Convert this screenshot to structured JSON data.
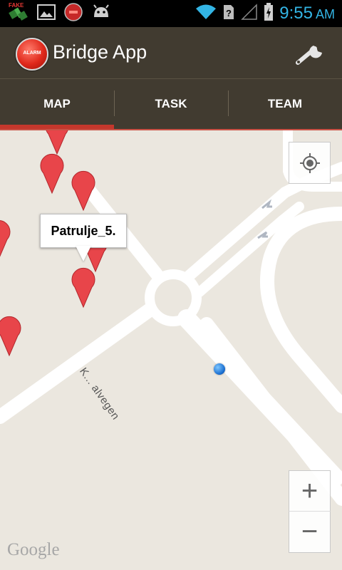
{
  "status_bar": {
    "time": "9:55",
    "ampm": "AM",
    "notification_icons": [
      "fake-gps-icon",
      "image-icon",
      "alarm-app-icon",
      "android-icon"
    ],
    "system_icons": [
      "wifi-icon",
      "no-sim-icon",
      "signal-icon",
      "battery-icon"
    ],
    "fake_label": "FAKE"
  },
  "action_bar": {
    "app_title": "Bridge App",
    "logo_text": "ALARM",
    "settings_icon": "wrench-icon"
  },
  "tabs": [
    {
      "label": "MAP",
      "active": true
    },
    {
      "label": "TASK",
      "active": false
    },
    {
      "label": "TEAM",
      "active": false
    }
  ],
  "map": {
    "callout_text": "Patrulje_5.",
    "street_label": "K... alvegen",
    "google_logo": "Google",
    "zoom_in_label": "+",
    "zoom_out_label": "−",
    "colors": {
      "land": "#ebe7df",
      "road": "#ffffff",
      "pin": "#e8454a",
      "accent": "#c4372c",
      "actionbar": "#413b30",
      "time": "#33b5e5"
    }
  }
}
